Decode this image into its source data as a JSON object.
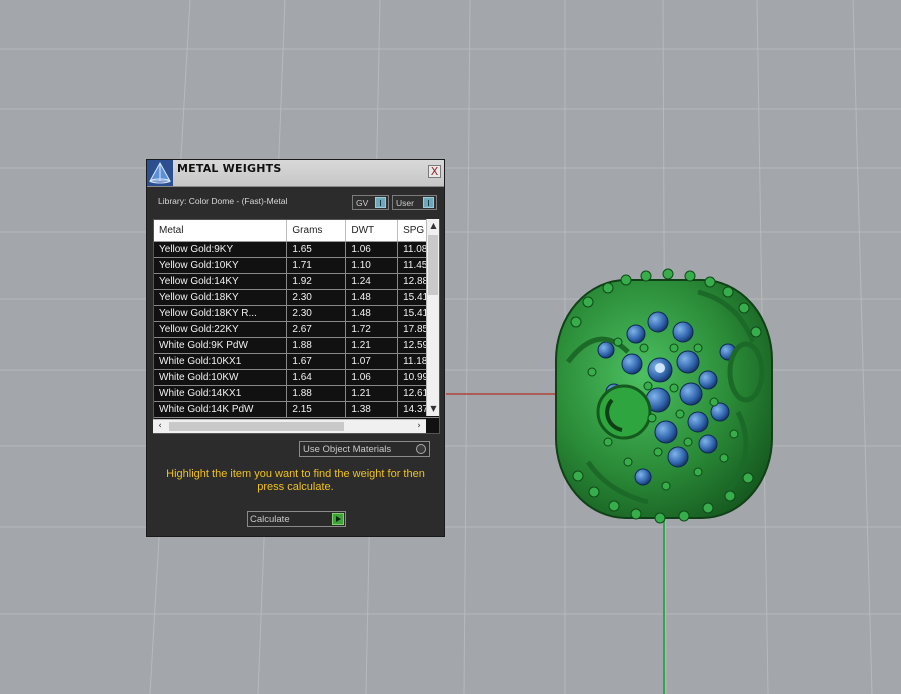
{
  "dialog": {
    "title": "METAL WEIGHTS",
    "close_label": "X",
    "library_label": "Library: Color Dome - (Fast)-Metal",
    "toggle_gv_label": "GV",
    "toggle_user_label": "User",
    "use_object_materials_label": "Use Object Materials",
    "hint_text": "Highlight the item you want to find the weight for then press calculate.",
    "calculate_label": "Calculate"
  },
  "table": {
    "headers": [
      "Metal",
      "Grams",
      "DWT",
      "SPG"
    ],
    "rows": [
      [
        "Yellow Gold:9KY",
        "1.65",
        "1.06",
        "11.08"
      ],
      [
        "Yellow Gold:10KY",
        "1.71",
        "1.10",
        "11.45"
      ],
      [
        "Yellow Gold:14KY",
        "1.92",
        "1.24",
        "12.88"
      ],
      [
        "Yellow Gold:18KY",
        "2.30",
        "1.48",
        "15.41"
      ],
      [
        "Yellow Gold:18KY R...",
        "2.30",
        "1.48",
        "15.41"
      ],
      [
        "Yellow Gold:22KY",
        "2.67",
        "1.72",
        "17.85"
      ],
      [
        "White Gold:9K PdW",
        "1.88",
        "1.21",
        "12.59"
      ],
      [
        "White Gold:10KX1",
        "1.67",
        "1.07",
        "11.18"
      ],
      [
        "White Gold:10KW",
        "1.64",
        "1.06",
        "10.99"
      ],
      [
        "White Gold:14KX1",
        "1.88",
        "1.21",
        "12.61"
      ],
      [
        "White Gold:14K PdW",
        "2.15",
        "1.38",
        "14.37"
      ]
    ]
  },
  "colors": {
    "viewport_bg": "#a3a7ab",
    "dialog_bg": "#2c2c2c",
    "hint_text": "#f0c21a",
    "model_green": "#2e8f3a",
    "gem_blue": "#2c5fa8",
    "axis_red": "#c0392b",
    "axis_green": "#2ecc40"
  },
  "icons": {
    "app": "pyramid-app-icon",
    "close": "close-icon",
    "scroll_up": "chevron-up-icon",
    "scroll_down": "chevron-down-icon",
    "scroll_left": "chevron-left-icon",
    "scroll_right": "chevron-right-icon",
    "calculate": "play-icon"
  }
}
